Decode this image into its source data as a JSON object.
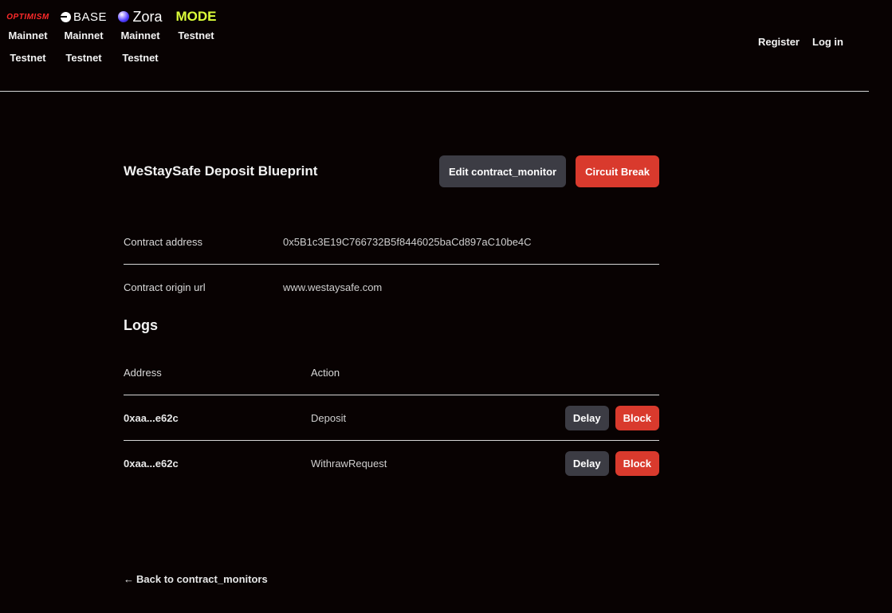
{
  "networks": [
    {
      "name": "OPTIMISM",
      "links": [
        "Mainnet",
        "Testnet"
      ]
    },
    {
      "name": "BASE",
      "links": [
        "Mainnet",
        "Testnet"
      ]
    },
    {
      "name": "Zora",
      "links": [
        "Mainnet",
        "Testnet"
      ]
    },
    {
      "name": "MODE",
      "links": [
        "Testnet"
      ]
    }
  ],
  "auth": {
    "register": "Register",
    "login": "Log in"
  },
  "page": {
    "title": "WeStaySafe Deposit Blueprint",
    "edit_button": "Edit contract_monitor",
    "circuit_button": "Circuit Break"
  },
  "info": [
    {
      "label": "Contract address",
      "value": "0x5B1c3E19C766732B5f8446025baCd897aC10be4C"
    },
    {
      "label": "Contract origin url",
      "value": "www.westaysafe.com"
    }
  ],
  "logs": {
    "title": "Logs",
    "headers": {
      "address": "Address",
      "action": "Action"
    },
    "rows": [
      {
        "address": "0xaa...e62c",
        "action": "Deposit",
        "delay": "Delay",
        "block": "Block"
      },
      {
        "address": "0xaa...e62c",
        "action": "WithrawRequest",
        "delay": "Delay",
        "block": "Block"
      }
    ]
  },
  "back": {
    "arrow": "←",
    "label": "Back to contract_monitors"
  },
  "colors": {
    "background": "#080202",
    "danger": "#d93a2d",
    "neutral": "#3c3c44",
    "mode_brand": "#dcff3a",
    "optimism_brand": "#ff2a2a"
  }
}
